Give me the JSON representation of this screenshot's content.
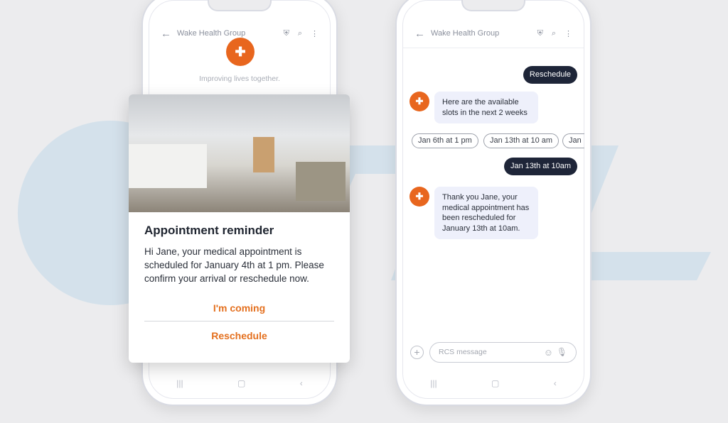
{
  "left_phone": {
    "title": "Wake Health Group",
    "tagline": "Improving lives together."
  },
  "card": {
    "title": "Appointment reminder",
    "body": "Hi Jane, your medical appointment is scheduled for January 4th at 1 pm. Please confirm your arrival or reschedule now.",
    "primary_action": "I'm coming",
    "secondary_action": "Reschedule"
  },
  "right_phone": {
    "title": "Wake Health Group",
    "messages": [
      {
        "from": "user",
        "text": "Reschedule"
      },
      {
        "from": "business",
        "text": "Here are the available slots in the next 2 weeks"
      },
      {
        "from": "user",
        "text": "Jan 13th at 10am"
      },
      {
        "from": "business",
        "text": "Thank you Jane, your medical appointment has been rescheduled for January 13th at 10am."
      }
    ],
    "chips": [
      "Jan 6th at 1 pm",
      "Jan 13th at 10 am",
      "Jan"
    ],
    "compose_placeholder": "RCS message"
  },
  "colors": {
    "accent": "#e8661e",
    "user_bubble": "#1e2538",
    "business_bubble": "#eef0fb"
  }
}
